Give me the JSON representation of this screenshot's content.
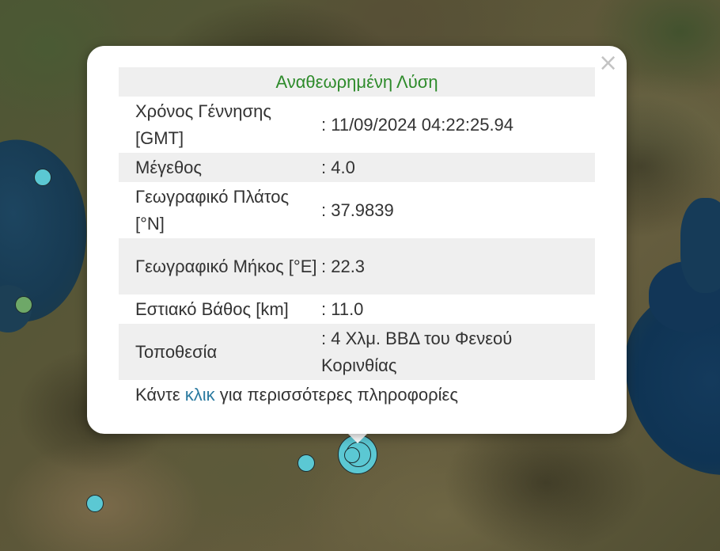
{
  "popup": {
    "title": "Αναθεωρημένη Λύση",
    "rows": [
      {
        "label": "Χρόνος Γέννησης [GMT]",
        "value": ": 11/09/2024 04:22:25.94"
      },
      {
        "label": "Μέγεθος",
        "value": ": 4.0"
      },
      {
        "label": "Γεωγραφικό Πλάτος [°N]",
        "value": ": 37.9839"
      },
      {
        "label": "Γεωγραφικό Μήκος [°E]",
        "value": ": 22.3"
      },
      {
        "label": "Εστιακό Βάθος [km]",
        "value": ": 11.0"
      },
      {
        "label": "Τοποθεσία",
        "value": ": 4 Χλμ. ΒΒΔ του Φενεού Κορινθίας"
      }
    ],
    "footer_prefix": "Κάντε",
    "footer_link": "κλικ",
    "footer_suffix": "για περισσότερες πληροφορίες",
    "close_symbol": "×"
  },
  "colors": {
    "title": "#2e8b2b",
    "link": "#2b7aa0",
    "marker_cyan": "#5bc8d3",
    "marker_green": "#6ea868"
  }
}
